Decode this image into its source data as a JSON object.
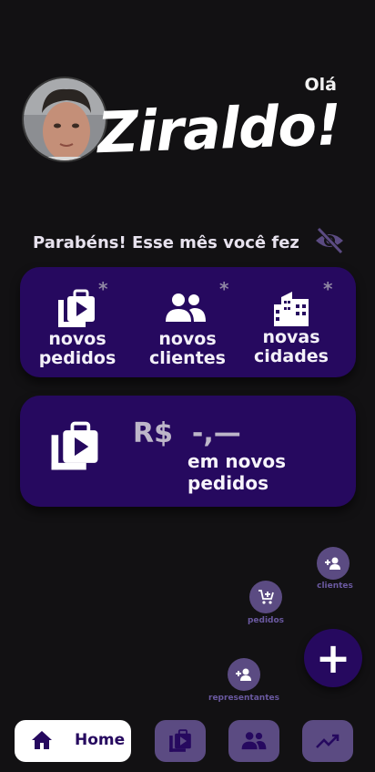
{
  "header": {
    "greeting_small": "Olá",
    "user_name": "Ziraldo!"
  },
  "summary": {
    "congrats": "Parabéns! Esse mês você fez",
    "stats": [
      {
        "line1": "novos",
        "line2": "pedidos",
        "icon": "orders-icon",
        "mark": "*"
      },
      {
        "line1": "novos",
        "line2": "clientes",
        "icon": "people-icon",
        "mark": "*"
      },
      {
        "line1": "novas",
        "line2": "cidades",
        "icon": "city-icon",
        "mark": "*"
      }
    ],
    "money_value": "R$  -,—",
    "money_caption": "em novos pedidos"
  },
  "speed_dial": {
    "clientes": "clientes",
    "pedidos": "pedidos",
    "representantes": "representantes",
    "main": "+"
  },
  "nav": {
    "home_label": "Home"
  },
  "colors": {
    "background": "#121113",
    "card": "#26095f",
    "muted_button": "#5b4b82"
  }
}
